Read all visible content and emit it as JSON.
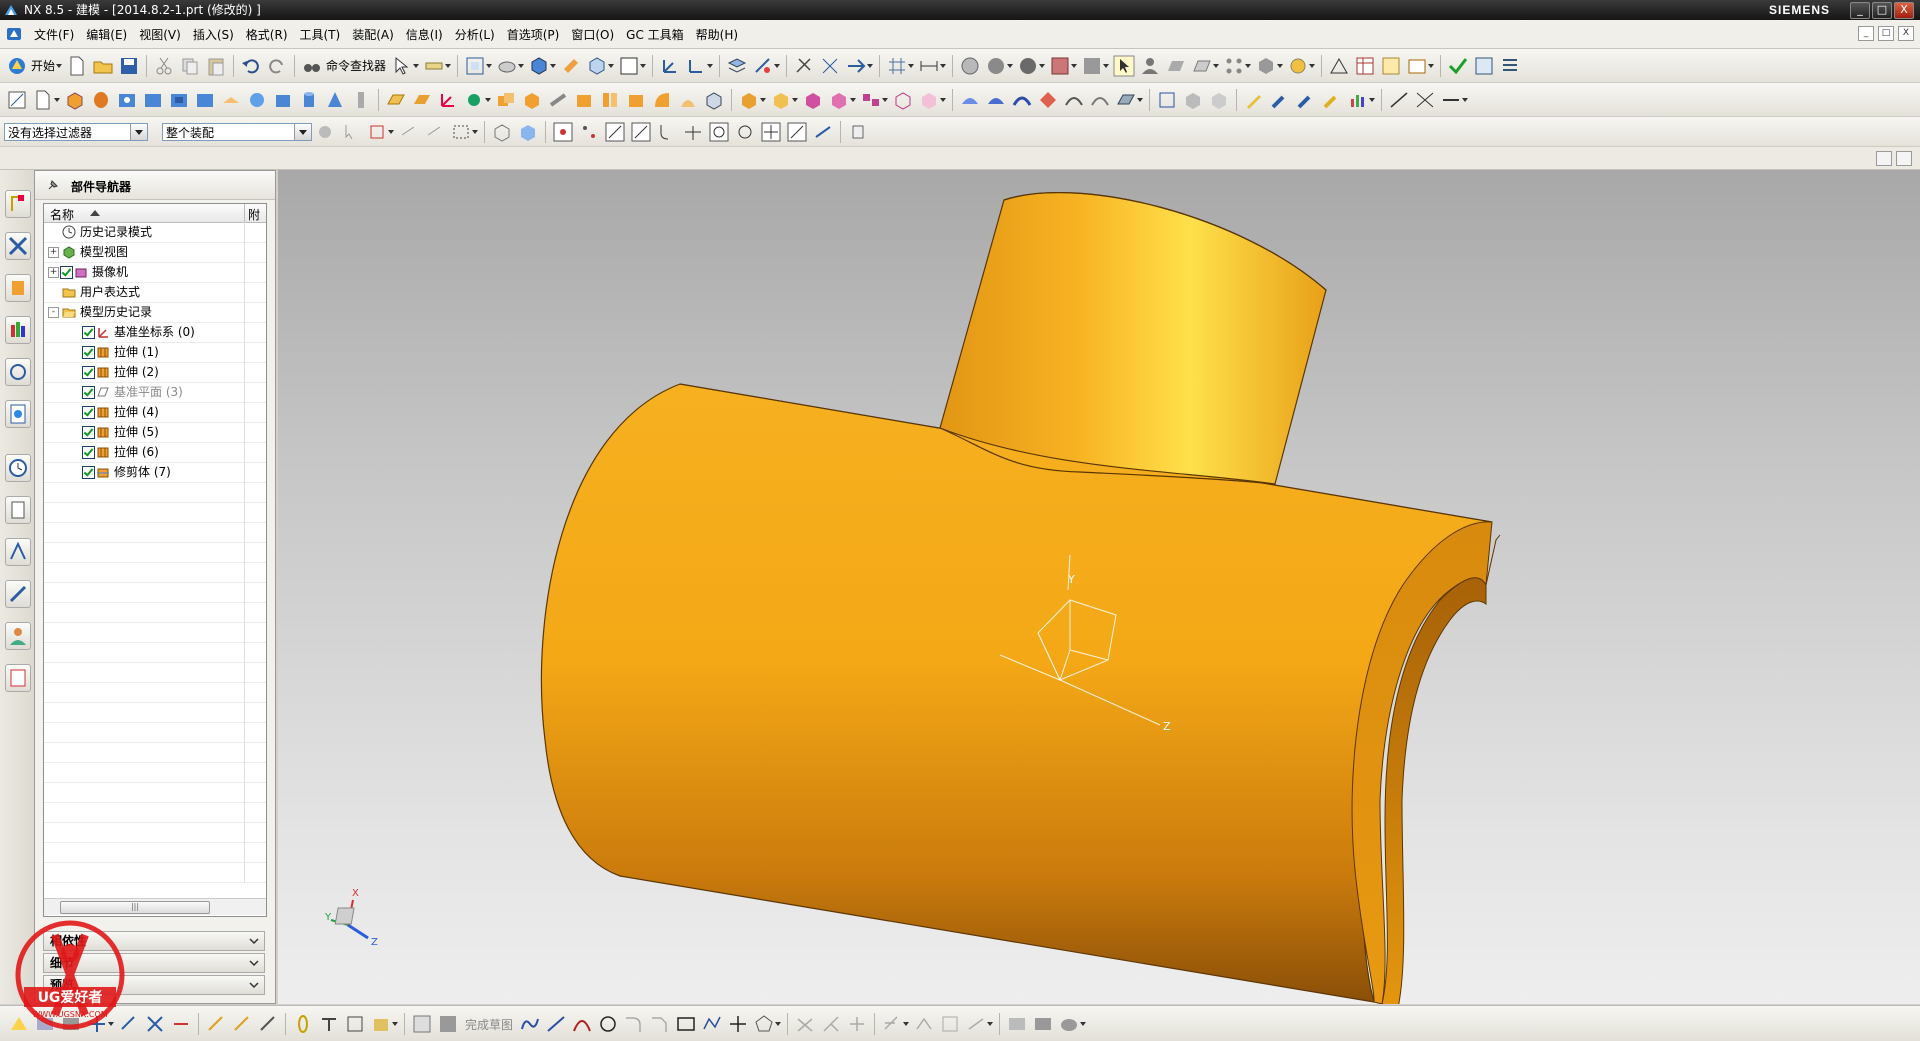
{
  "window": {
    "title": "NX 8.5 - 建模 - [2014.8.2-1.prt (修改的) ]",
    "brand": "SIEMENS",
    "controls": [
      "_",
      "□",
      "X"
    ]
  },
  "menu": {
    "items": [
      "文件(F)",
      "编辑(E)",
      "视图(V)",
      "插入(S)",
      "格式(R)",
      "工具(T)",
      "装配(A)",
      "信息(I)",
      "分析(L)",
      "首选项(P)",
      "窗口(O)",
      "GC 工具箱",
      "帮助(H)"
    ]
  },
  "toolbar": {
    "start_label": "开始",
    "command_finder_label": "命令查找器",
    "selection_filter": "没有选择过滤器",
    "assembly_scope": "整个装配"
  },
  "navigator": {
    "title": "部件导航器",
    "col_name": "名称",
    "col_extra": "附",
    "rows": [
      {
        "label": "历史记录模式",
        "level": 0,
        "expander": "",
        "checked": false,
        "icon": "clock-icon",
        "dim": false
      },
      {
        "label": "模型视图",
        "level": 0,
        "expander": "+",
        "checked": false,
        "icon": "model-views-icon",
        "dim": false
      },
      {
        "label": "摄像机",
        "level": 0,
        "expander": "+",
        "checked": true,
        "icon": "camera-icon",
        "dim": false
      },
      {
        "label": "用户表达式",
        "level": 0,
        "expander": "",
        "checked": false,
        "icon": "folder-icon",
        "dim": false
      },
      {
        "label": "模型历史记录",
        "level": 0,
        "expander": "-",
        "checked": false,
        "icon": "folder-open-icon",
        "dim": false
      },
      {
        "label": "基准坐标系 (0)",
        "level": 1,
        "expander": "",
        "checked": true,
        "icon": "datum-csys-icon",
        "dim": false
      },
      {
        "label": "拉伸 (1)",
        "level": 1,
        "expander": "",
        "checked": true,
        "icon": "extrude-icon",
        "dim": false
      },
      {
        "label": "拉伸 (2)",
        "level": 1,
        "expander": "",
        "checked": true,
        "icon": "extrude-icon",
        "dim": false
      },
      {
        "label": "基准平面 (3)",
        "level": 1,
        "expander": "",
        "checked": true,
        "icon": "datum-plane-icon",
        "dim": true
      },
      {
        "label": "拉伸 (4)",
        "level": 1,
        "expander": "",
        "checked": true,
        "icon": "extrude-icon",
        "dim": false
      },
      {
        "label": "拉伸 (5)",
        "level": 1,
        "expander": "",
        "checked": true,
        "icon": "extrude-icon",
        "dim": false
      },
      {
        "label": "拉伸 (6)",
        "level": 1,
        "expander": "",
        "checked": true,
        "icon": "extrude-icon",
        "dim": false
      },
      {
        "label": "修剪体 (7)",
        "level": 1,
        "expander": "",
        "checked": true,
        "icon": "trim-body-icon",
        "dim": false
      }
    ],
    "panels": [
      "相依性",
      "细节",
      "预览"
    ]
  },
  "viewport": {
    "part_color": "#f2a712",
    "triad_labels": [
      "X",
      "Y",
      "Z"
    ]
  },
  "bottom": {
    "finish_sketch_label": "完成草图"
  },
  "watermark": {
    "text": "UG爱好者",
    "url": "WWW.UGSNX.COM"
  }
}
